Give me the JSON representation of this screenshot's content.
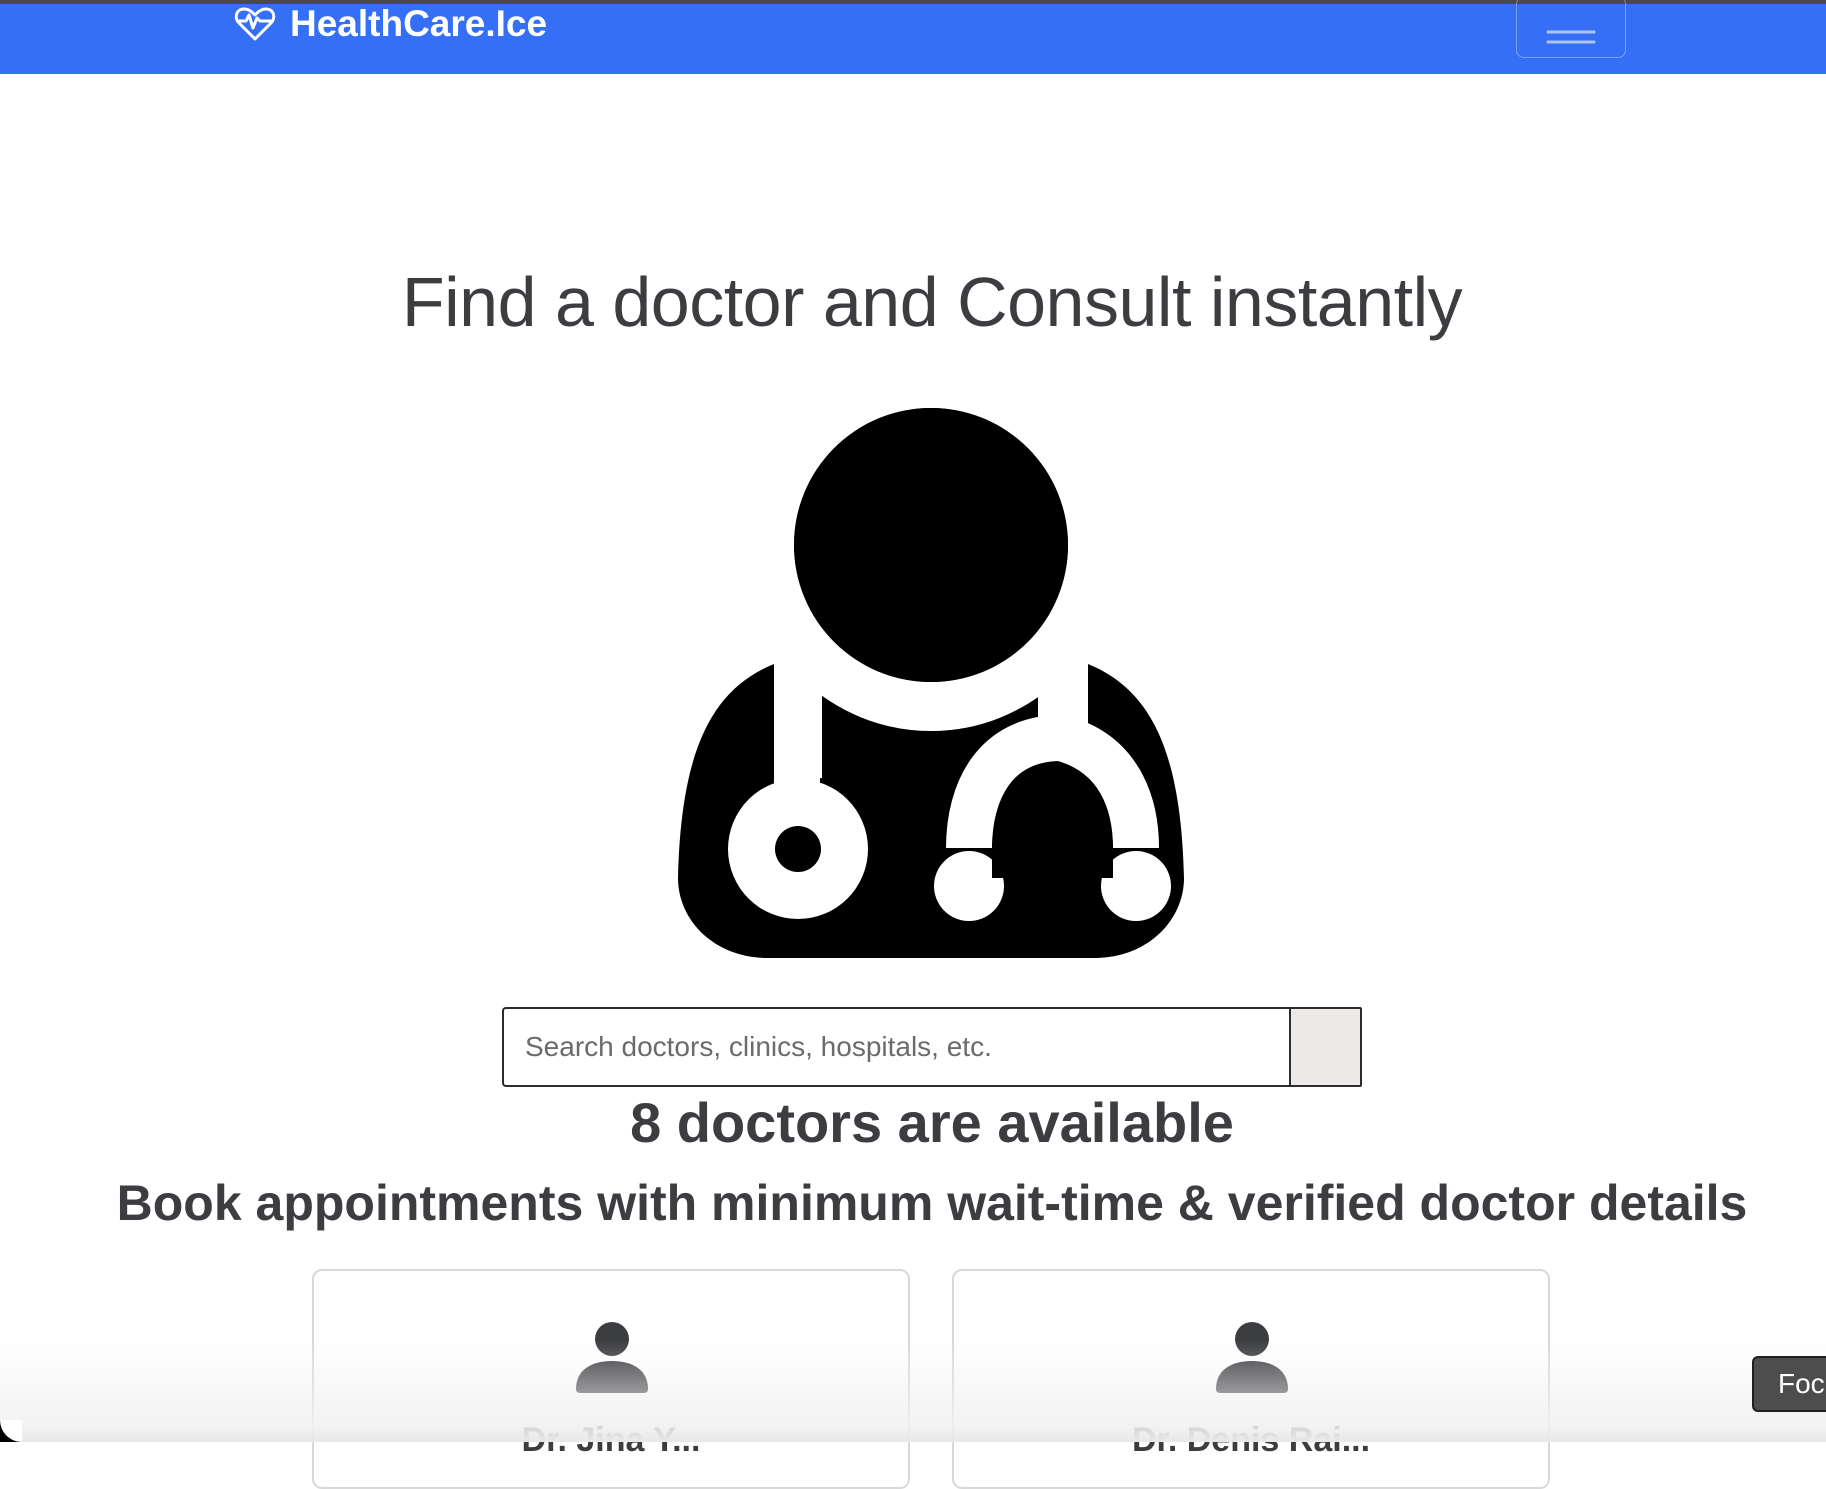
{
  "navbar": {
    "brand_text": "HealthCare.Ice",
    "brand_icon": "heart-pulse-icon",
    "toggler_icon": "hamburger-menu-icon",
    "accent_color": "#356ff5"
  },
  "hero": {
    "title": "Find a doctor and Consult instantly",
    "illustration_icon": "doctor-stethoscope-icon"
  },
  "search": {
    "placeholder": "Search doctors, clinics, hospitals, etc.",
    "value": ""
  },
  "availability": {
    "count_text": "8 doctors are available",
    "subtitle": "Book appointments with minimum wait-time & verified doctor details"
  },
  "doctors": [
    {
      "avatar_icon": "user-icon",
      "name": "Dr. Jina Y..."
    },
    {
      "avatar_icon": "user-icon",
      "name": "Dr. Denis Rai..."
    }
  ],
  "floating": {
    "focus_label": "Focus"
  }
}
